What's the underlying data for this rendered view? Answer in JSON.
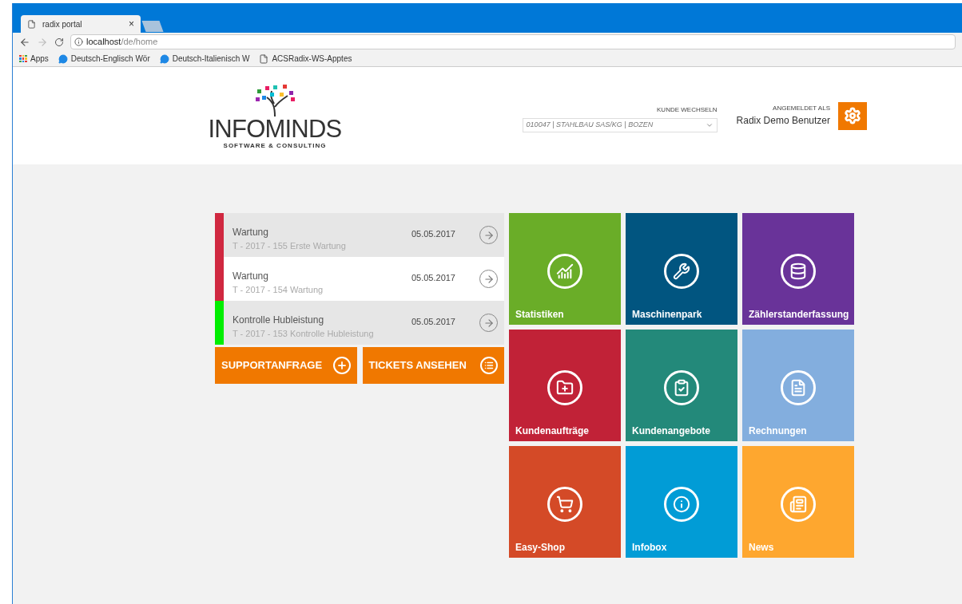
{
  "browser": {
    "tabs": [
      {
        "title": "radix portal",
        "close": "×"
      }
    ],
    "address": {
      "host": "localhost",
      "path": "/de/home"
    },
    "bookmarks": [
      {
        "kind": "apps",
        "label": "Apps"
      },
      {
        "kind": "bubble",
        "label": "Deutsch-Englisch Wör"
      },
      {
        "kind": "bubble",
        "label": "Deutsch-Italienisch W"
      },
      {
        "kind": "page",
        "label": "ACSRadix-WS-Apptes"
      }
    ]
  },
  "header": {
    "logo": {
      "name": "INFOMINDS",
      "tagline": "SOFTWARE & CONSULTING"
    },
    "customer_switch": {
      "label": "KUNDE WECHSELN",
      "value": "010047 | STAHLBAU SAS/KG | BOZEN"
    },
    "user": {
      "label": "ANGEMELDET ALS",
      "name": "Radix Demo Benutzer"
    }
  },
  "tickets": [
    {
      "title": "Wartung",
      "subtitle": "T - 2017 - 155 Erste Wartung",
      "date": "05.05.2017",
      "color": "#d02840",
      "selected": false
    },
    {
      "title": "Wartung",
      "subtitle": "T - 2017 - 154 Wartung",
      "date": "05.05.2017",
      "color": "#d02840",
      "selected": true
    },
    {
      "title": "Kontrolle Hubleistung",
      "subtitle": "T - 2017 - 153 Kontrolle Hubleistung",
      "date": "05.05.2017",
      "color": "#00ee00",
      "selected": false
    }
  ],
  "actions": [
    {
      "kind": "add",
      "label": "SUPPORTANFRAGE"
    },
    {
      "kind": "list",
      "label": "TICKETS ANSEHEN"
    }
  ],
  "tiles": [
    {
      "kind": "chart",
      "label": "Statistiken",
      "color": "#6aad28"
    },
    {
      "kind": "tools",
      "label": "Maschinenpark",
      "color": "#015580"
    },
    {
      "kind": "database",
      "label": "Zählerstanderfassung",
      "color": "#693399"
    },
    {
      "kind": "folder",
      "label": "Kundenaufträge",
      "color": "#c12237"
    },
    {
      "kind": "clipboard",
      "label": "Kundenangebote",
      "color": "#23897a"
    },
    {
      "kind": "invoice",
      "label": "Rechnungen",
      "color": "#83aede"
    },
    {
      "kind": "cart",
      "label": "Easy-Shop",
      "color": "#d44a27"
    },
    {
      "kind": "info",
      "label": "Infobox",
      "color": "#019cd6"
    },
    {
      "kind": "news",
      "label": "News",
      "color": "#fea72f"
    }
  ]
}
